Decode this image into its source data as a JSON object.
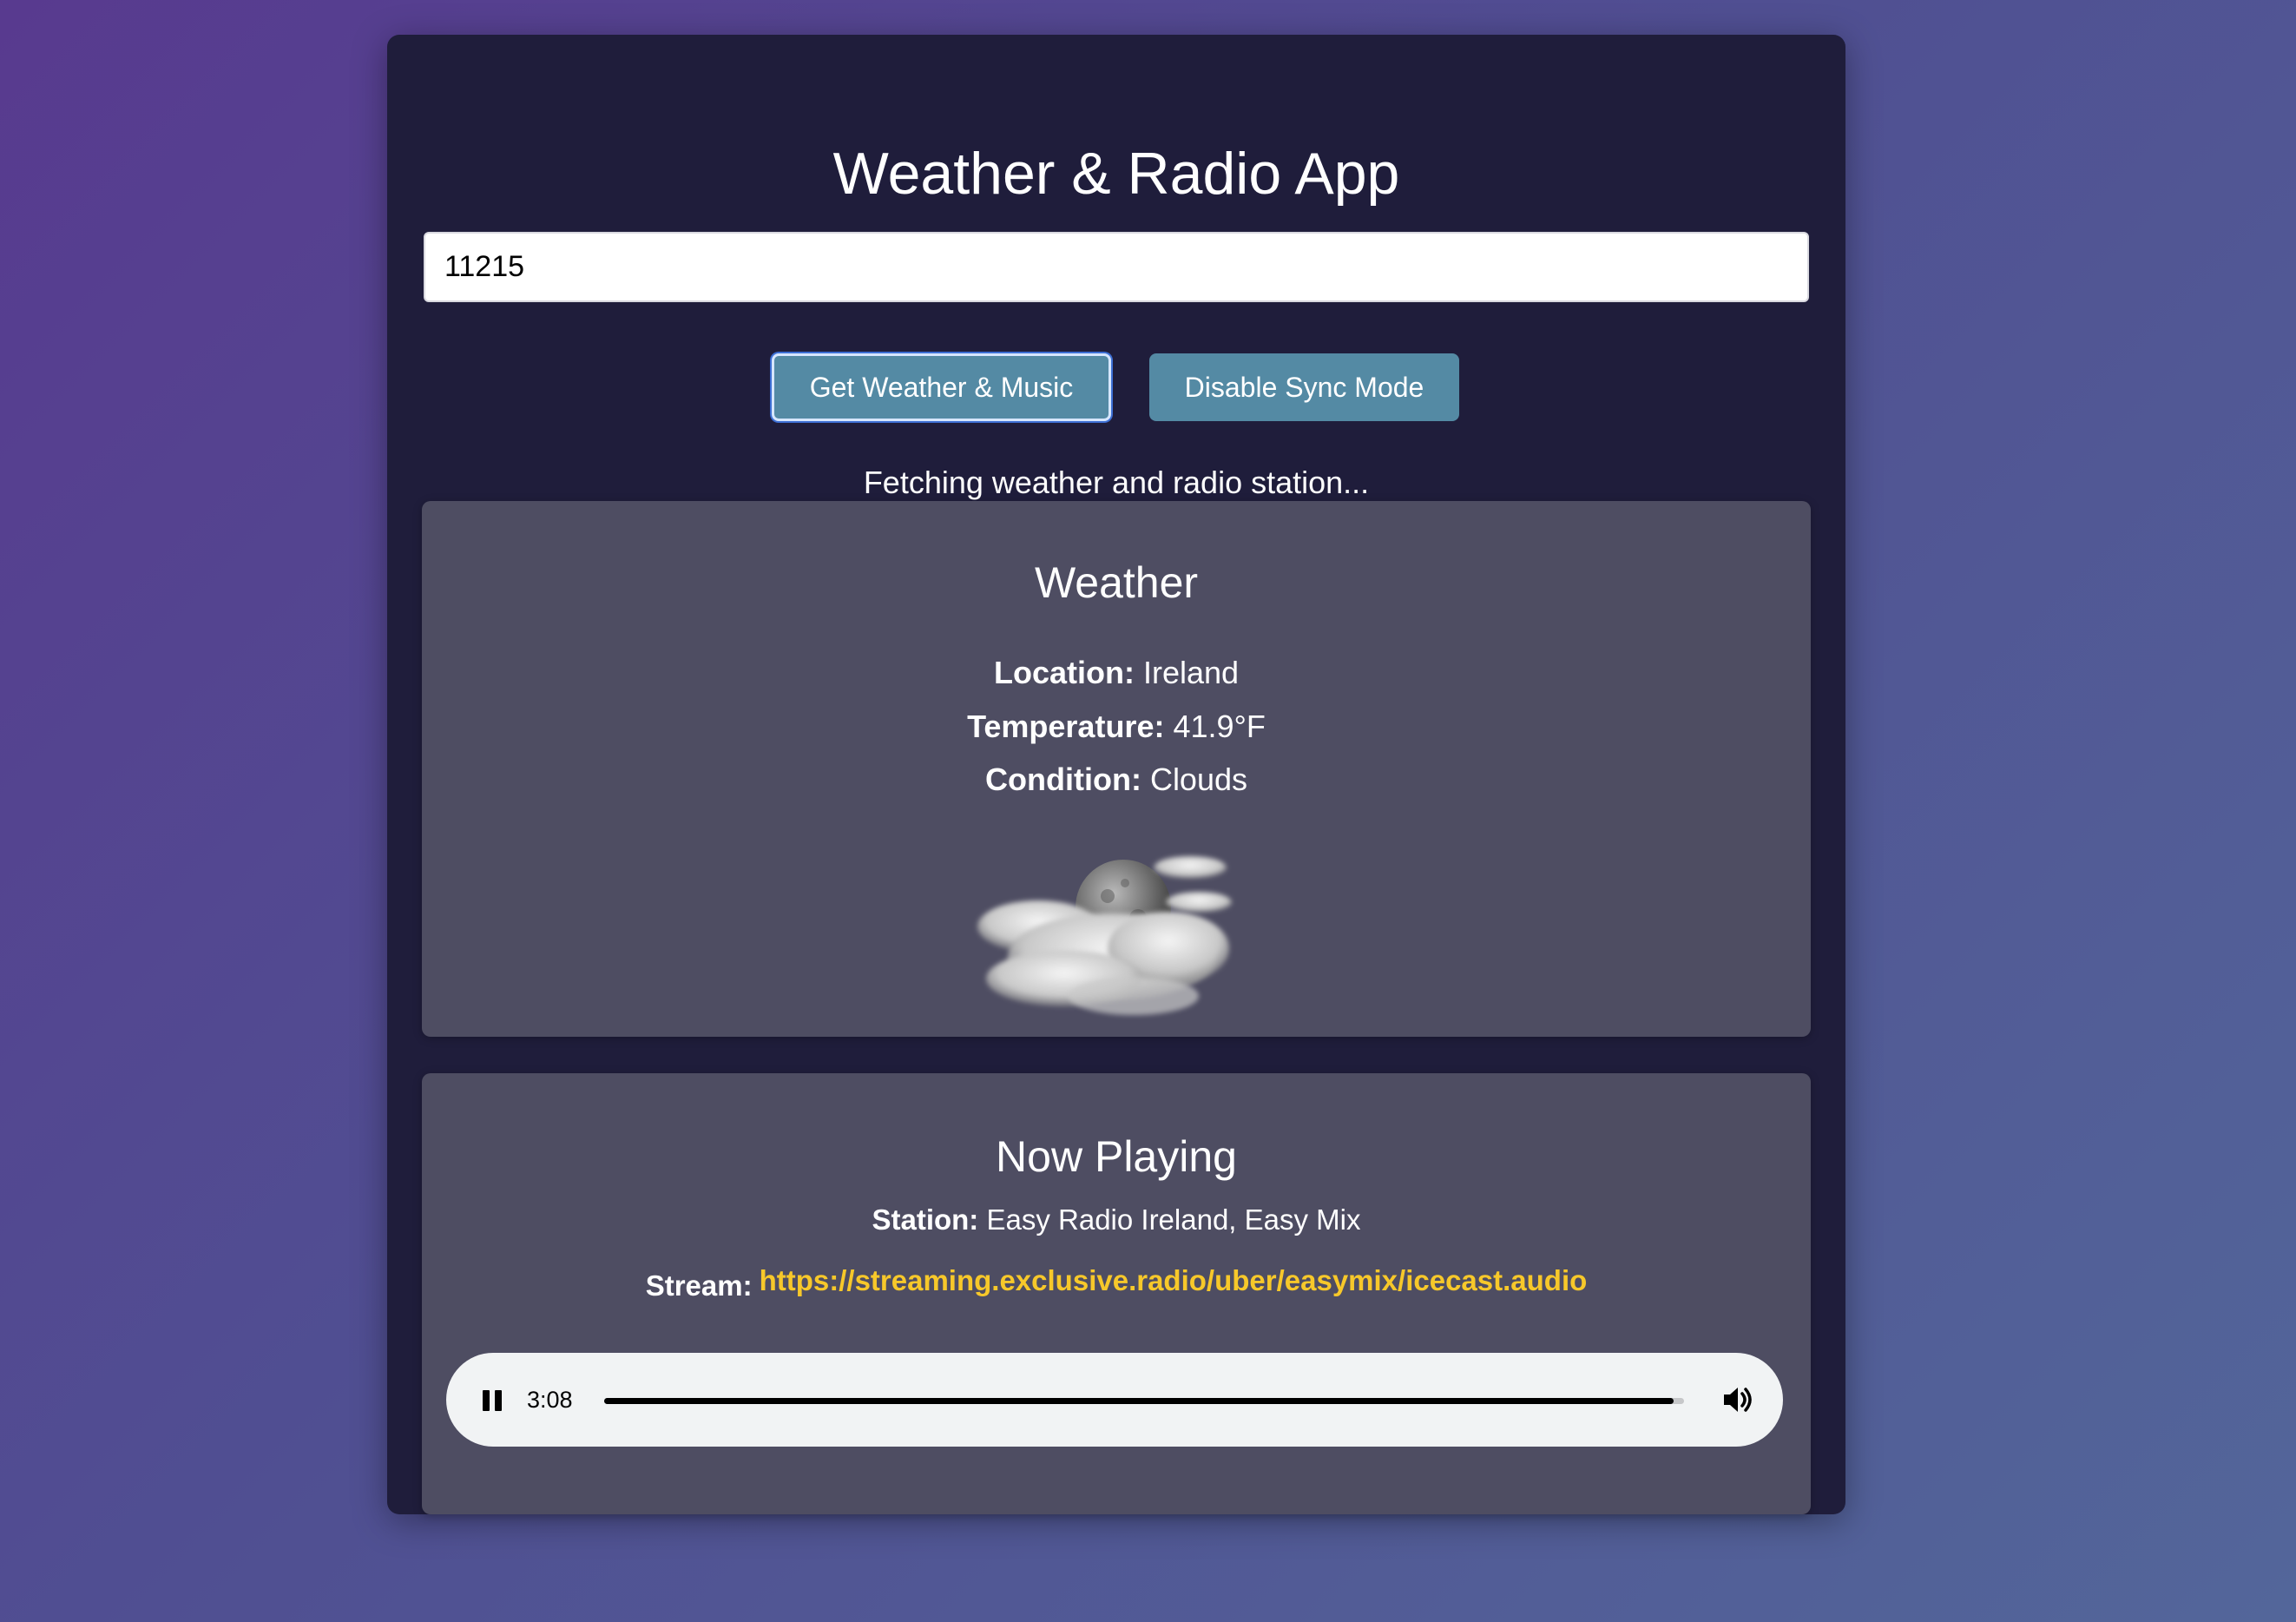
{
  "app": {
    "title": "Weather & Radio App"
  },
  "search": {
    "value": "11215"
  },
  "buttons": {
    "get_weather_label": "Get Weather & Music",
    "sync_label": "Disable Sync Mode"
  },
  "status": {
    "text": "Fetching weather and radio station..."
  },
  "weather": {
    "heading": "Weather",
    "location_label": "Location:",
    "location_value": " Ireland",
    "temperature_label": "Temperature:",
    "temperature_value": " 41.9°F",
    "condition_label": "Condition:",
    "condition_value": " Clouds",
    "icon": "night-clouds-moon-icon"
  },
  "radio": {
    "heading": "Now Playing",
    "station_label": "Station:",
    "station_value": " Easy Radio Ireland, Easy Mix",
    "stream_label": "Stream:",
    "stream_url": "https://streaming.exclusive.radio/uber/easymix/icecast.audio"
  },
  "player": {
    "state_icon": "pause-icon",
    "current_time": "3:08",
    "progress": 0.99,
    "volume_icon": "volume-icon"
  },
  "colors": {
    "background_start": "#583a8f",
    "background_end": "#53669a",
    "panel": "#1f1d3b",
    "card": "#4e4d62",
    "button": "#548aa4",
    "link": "#f7c82a",
    "player_bg": "#f1f3f4"
  }
}
